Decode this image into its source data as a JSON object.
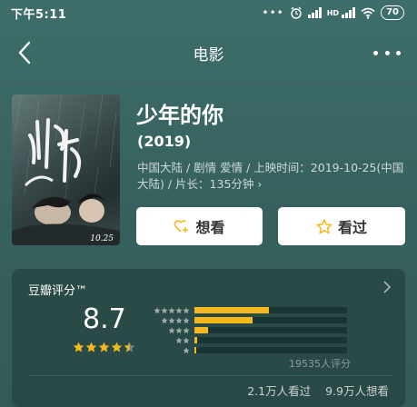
{
  "status_bar": {
    "time": "下午5:11",
    "dots": "•••",
    "hd": "HD",
    "battery": "70"
  },
  "nav": {
    "title": "电影"
  },
  "movie": {
    "title": "少年的你",
    "year": "(2019)",
    "meta": "中国大陆 / 剧情 爱情 / 上映时间：2019-10-25(中国大陆) / 片长：135分钟 ›",
    "poster_date": "10.25"
  },
  "actions": {
    "want_label": "想看",
    "seen_label": "看过"
  },
  "rating": {
    "header": "豆瓣评分™",
    "score": "8.7",
    "stars_filled": 4.5,
    "distribution": [
      {
        "stars": 5,
        "fraction": 0.49
      },
      {
        "stars": 4,
        "fraction": 0.38
      },
      {
        "stars": 3,
        "fraction": 0.09
      },
      {
        "stars": 2,
        "fraction": 0.015
      },
      {
        "stars": 1,
        "fraction": 0.01
      }
    ],
    "raters": "19535人评分",
    "watched": "2.1万人看过",
    "want_to_watch": "9.9万人想看"
  },
  "colors": {
    "accent": "#f5b81e",
    "background": "#3e6e6b",
    "panel": "#284644"
  }
}
